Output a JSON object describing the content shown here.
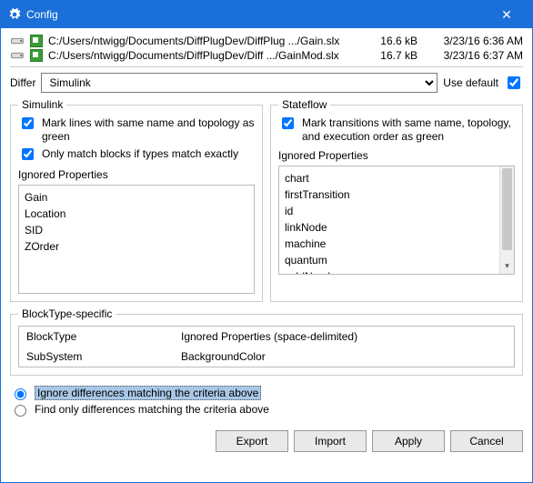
{
  "window": {
    "title": "Config"
  },
  "files": [
    {
      "path": "C:/Users/ntwigg/Documents/DiffPlugDev/DiffPlug .../Gain.slx",
      "size": "16.6 kB",
      "date": "3/23/16 6:36 AM"
    },
    {
      "path": "C:/Users/ntwigg/Documents/DiffPlugDev/Diff .../GainMod.slx",
      "size": "16.7 kB",
      "date": "3/23/16 6:37 AM"
    }
  ],
  "differ": {
    "label": "Differ",
    "value": "Simulink",
    "use_default": "Use default"
  },
  "simulink": {
    "legend": "Simulink",
    "chk1": "Mark lines with same name and topology as green",
    "chk2": "Only match blocks if types match exactly",
    "ignored_label": "Ignored Properties",
    "items": [
      "Gain",
      "Location",
      "SID",
      "ZOrder"
    ]
  },
  "stateflow": {
    "legend": "Stateflow",
    "chk1": "Mark transitions with same name, topology, and execution order as green",
    "ignored_label": "Ignored Properties",
    "items": [
      "chart",
      "firstTransition",
      "id",
      "linkNode",
      "machine",
      "quantum",
      "ssIdNumber"
    ]
  },
  "blocktype": {
    "legend": "BlockType-specific",
    "col1": "BlockType",
    "col2": "Ignored Properties (space-delimited)",
    "row1": "SubSystem",
    "row2": "BackgroundColor"
  },
  "radios": {
    "opt1": "Ignore differences matching the criteria above",
    "opt2": "Find only differences matching the criteria above"
  },
  "buttons": {
    "export": "Export",
    "import": "Import",
    "apply": "Apply",
    "cancel": "Cancel"
  }
}
